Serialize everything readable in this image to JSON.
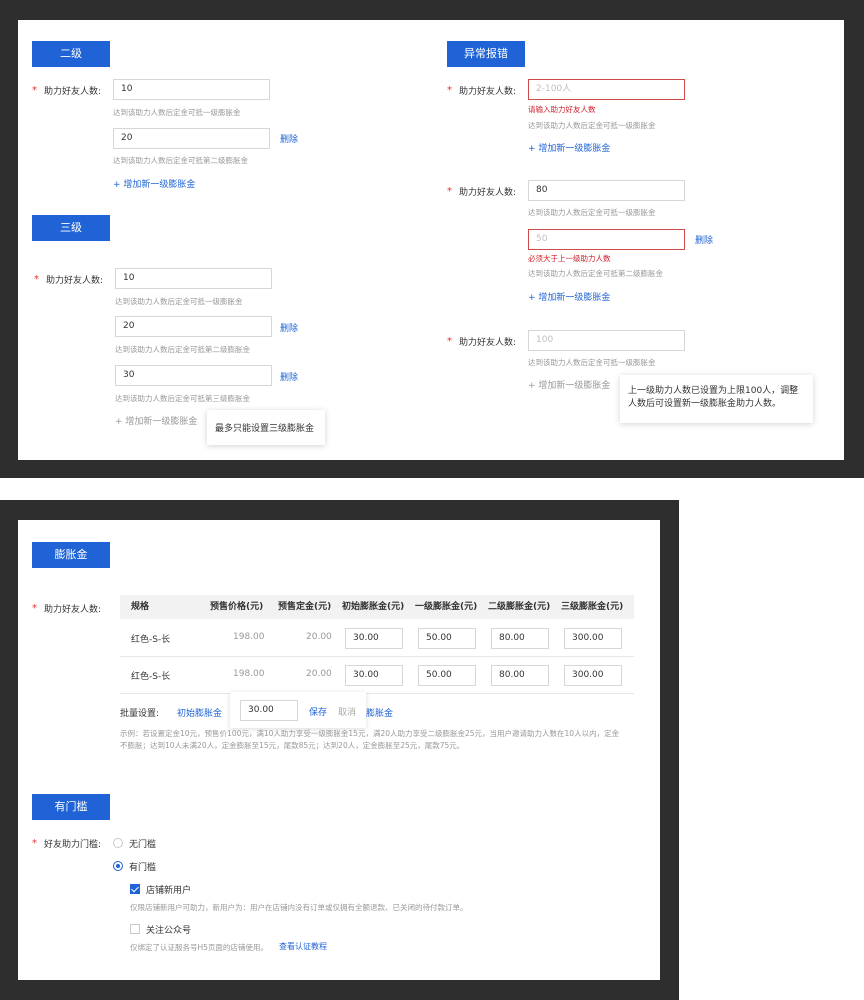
{
  "top": {
    "level2": {
      "title": "二级",
      "field_label": "助力好友人数:",
      "required_mark": "*",
      "rows": [
        {
          "value": "10",
          "hint": "达到该助力人数后定金可抵一级膨胀金"
        },
        {
          "value": "20",
          "hint": "达到该助力人数后定金可抵第二级膨胀金",
          "delete": "删除"
        }
      ],
      "add_label": "增加新一级膨胀金"
    },
    "level3": {
      "title": "三级",
      "field_label": "助力好友人数:",
      "required_mark": "*",
      "rows": [
        {
          "value": "10",
          "hint": "达到该助力人数后定金可抵一级膨胀金"
        },
        {
          "value": "20",
          "hint": "达到该助力人数后定金可抵第二级膨胀金",
          "delete": "删除"
        },
        {
          "value": "30",
          "hint": "达到该助力人数后定金可抵第三级膨胀金",
          "delete": "删除"
        }
      ],
      "add_label": "增加新一级膨胀金",
      "tooltip": "最多只能设置三级膨胀金"
    },
    "errors": {
      "title": "异常报错",
      "field_label": "助力好友人数:",
      "required_mark": "*",
      "block1": {
        "placeholder": "2-100人",
        "error": "请输入助力好友人数",
        "hint": "达到该助力人数后定金可抵一级膨胀金",
        "add_label": "增加新一级膨胀金"
      },
      "block2": {
        "value": "80",
        "hint1": "达到该助力人数后定金可抵一级膨胀金",
        "placeholder2": "50",
        "delete": "删除",
        "error": "必须大于上一级助力人数",
        "hint2": "达到该助力人数后定金可抵第二级膨胀金",
        "add_label": "增加新一级膨胀金"
      },
      "block3": {
        "placeholder": "100",
        "hint": "达到该助力人数后定金可抵一级膨胀金",
        "add_label": "增加新一级膨胀金",
        "tooltip_line1": "上一级助力人数已设置为上限100人，调整",
        "tooltip_line2": "人数后可设置新一级膨胀金助力人数。"
      }
    }
  },
  "bottom": {
    "expansion": {
      "title": "膨胀金",
      "field_label": "助力好友人数:",
      "required_mark": "*",
      "columns": [
        "规格",
        "预售价格(元)",
        "预售定金(元)",
        "初始膨胀金(元)",
        "一级膨胀金(元)",
        "二级膨胀金(元)",
        "三级膨胀金(元)"
      ],
      "rows": [
        {
          "spec": "红色-S-长",
          "price": "198.00",
          "deposit": "20.00",
          "initial": "30.00",
          "l1": "50.00",
          "l2": "80.00",
          "l3": "300.00"
        },
        {
          "spec": "红色-S-长",
          "price": "198.00",
          "deposit": "20.00",
          "initial": "30.00",
          "l1": "50.00",
          "l2": "80.00",
          "l3": "300.00"
        }
      ],
      "batch_label": "批量设置:",
      "batch_link": "初始膨胀金",
      "batch_value": "30.00",
      "batch_save": "保存",
      "batch_cancel": "取消",
      "batch_link_tail": "膨胀金",
      "example_line1": "示例：若设置定金10元，预售价100元，满10人助力享受一级膨胀金15元，满20人助力享受二级膨胀金25元，当用户邀请助力人数在10人以内，定金",
      "example_line2": "不膨胀；达到10人未满20人，定金膨胀至15元，尾款85元；达到20人，定金膨胀至25元，尾款75元。"
    },
    "threshold": {
      "title": "有门槛",
      "field_label": "好友助力门槛:",
      "required_mark": "*",
      "option_none": "无门槛",
      "option_has": "有门槛",
      "check_new_user": "店铺新用户",
      "check_new_user_desc": "仅限店铺新用户可助力，新用户为：用户在店铺内没有订单或仅拥有全额退款、已关闭的待付款订单。",
      "check_follow": "关注公众号",
      "check_follow_desc": "仅绑定了认证服务号H5页面的店铺使用。",
      "check_follow_link": "查看认证教程"
    }
  }
}
